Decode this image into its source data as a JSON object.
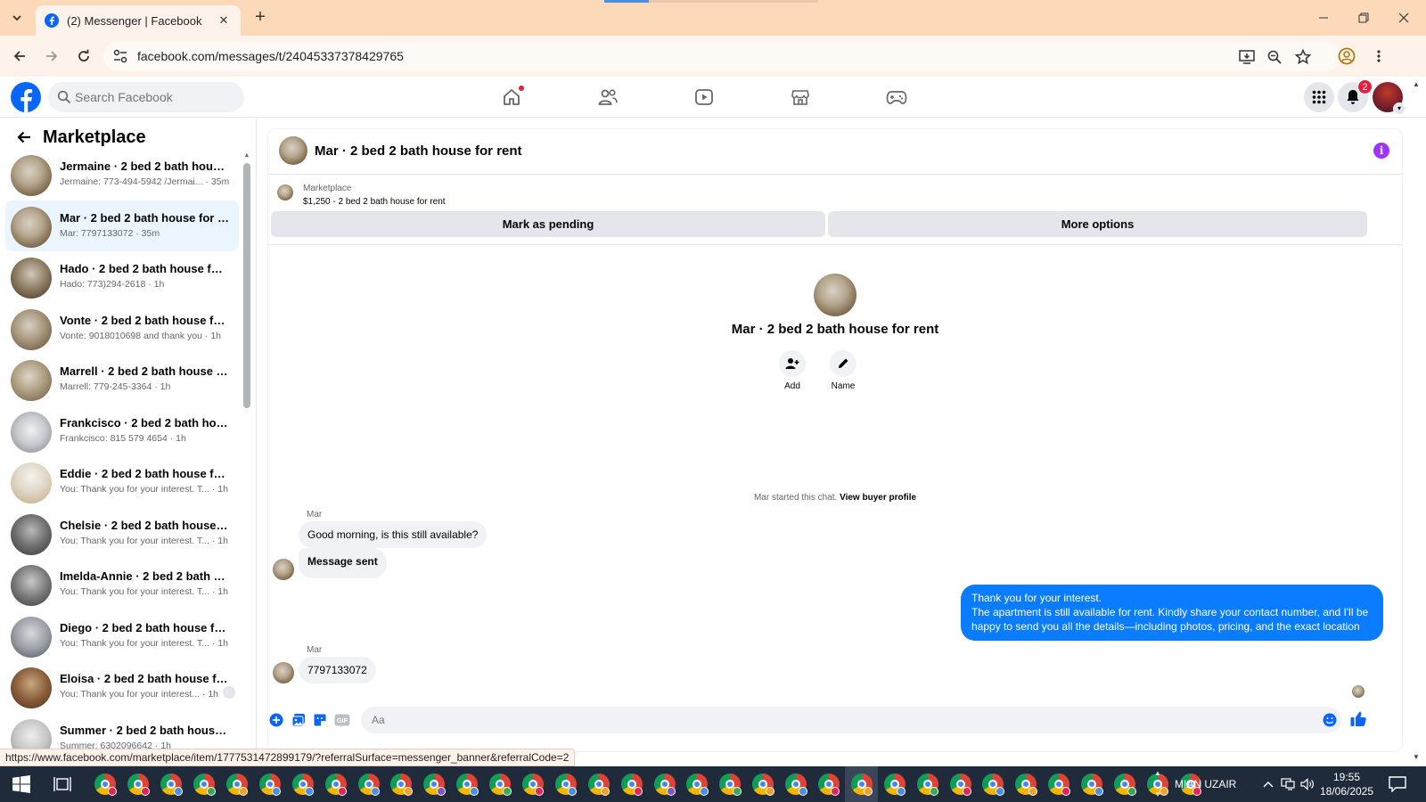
{
  "browser": {
    "tab_title": "(2) Messenger | Facebook",
    "tab_close": "✕",
    "new_tab": "+",
    "url": "facebook.com/messages/t/24045337378429765",
    "status_url": "https://www.facebook.com/marketplace/item/1777531472899179/?referralSurface=messenger_banner&referralCode=2"
  },
  "fb": {
    "search_placeholder": "Search Facebook",
    "notification_count": "2"
  },
  "sidebar": {
    "title": "Marketplace",
    "conversations": [
      {
        "name": "Jermaine · 2 bed 2 bath house for rent",
        "snippet": "Jermaine: 773-494-5942 /Jermai...",
        "time": "35m"
      },
      {
        "name": "Mar · 2 bed 2 bath house for rent",
        "snippet": "Mar: 7797133072",
        "time": "35m"
      },
      {
        "name": "Hado · 2 bed 2 bath house for rent",
        "snippet": "Hado: 773)294-2618",
        "time": "1h"
      },
      {
        "name": "Vonte · 2 bed 2 bath house for rent",
        "snippet": "Vonte: 9018010698 and thank you",
        "time": "1h"
      },
      {
        "name": "Marrell · 2 bed 2 bath house for rent",
        "snippet": "Marrell: 779-245-3364",
        "time": "1h"
      },
      {
        "name": "Frankcisco · 2 bed 2 bath house for rent",
        "snippet": "Frankcisco: 815 579 4654",
        "time": "1h"
      },
      {
        "name": "Eddie · 2 bed 2 bath house for rent",
        "snippet": "You: Thank you for your interest. T...",
        "time": "1h"
      },
      {
        "name": "Chelsie · 2 bed 2 bath house for rent",
        "snippet": "You: Thank you for your interest. T...",
        "time": "1h"
      },
      {
        "name": "Imelda-Annie · 2 bed 2 bath house for rent",
        "snippet": "You: Thank you for your interest. T...",
        "time": "1h"
      },
      {
        "name": "Diego · 2 bed 2 bath house for rent",
        "snippet": "You: Thank you for your interest. T...",
        "time": "1h"
      },
      {
        "name": "Eloisa · 2 bed 2 bath house for rent",
        "snippet": "You: Thank you for your interest...",
        "time": "1h"
      },
      {
        "name": "Summer · 2 bed 2 bath house for rent",
        "snippet": "Summer: 6302096642",
        "time": "1h"
      }
    ]
  },
  "chat": {
    "title": "Mar · 2 bed 2 bath house for rent",
    "info_icon": "i",
    "marketplace_label": "Marketplace",
    "listing": "$1,250 - 2 bed 2 bath house for rent",
    "mark_pending": "Mark as pending",
    "more_options": "More options",
    "intro_name": "Mar · 2 bed 2 bath house for rent",
    "add_label": "Add",
    "name_label": "Name",
    "started_text": "Mar started this chat.",
    "view_profile": "View buyer profile",
    "sender": "Mar",
    "msg1": "Good morning, is this still available?",
    "msg2": "Message sent",
    "reply_line1": "Thank you for your interest.",
    "reply_line2": "The apartment is still available for rent. Kindly share your contact number, and I'll be",
    "reply_line3": "happy to send you all the details—including photos, pricing, and the exact location",
    "sender2": "Mar",
    "msg3": "7797133072",
    "composer_placeholder": "Aa",
    "gif_label": "GIF"
  },
  "taskbar": {
    "user": "MIAN UZAIR",
    "time": "19:55",
    "date": "18/06/2025",
    "profile_colors": [
      "#e0245e",
      "#e0245e",
      "#4a8fe0",
      "#3aa85a",
      "#f0a030",
      "#4a8fe0",
      "#4a8fe0",
      "#e0245e",
      "#4a8fe0",
      "#f0a030",
      "#7e57c2",
      "#4a8fe0",
      "#3aa85a",
      "#e0245e",
      "#4a8fe0",
      "#f0a030",
      "#e0245e",
      "#7e57c2",
      "#4a8fe0",
      "#3aa85a",
      "#f0a030",
      "#4a8fe0",
      "#e0245e",
      "#f0a030",
      "#4a8fe0",
      "#3aa85a",
      "#e0245e",
      "#4a8fe0",
      "#f0a030",
      "#e0245e",
      "#4a8fe0",
      "#3aa85a",
      "#f0a030",
      "#e0245e"
    ]
  },
  "colors": {
    "accent_blue": "#0a7cff",
    "fb_blue": "#0866ff",
    "active_row": "#ebf5ff",
    "info_purple": "#a033ff",
    "notification_red": "#e41e3f"
  }
}
